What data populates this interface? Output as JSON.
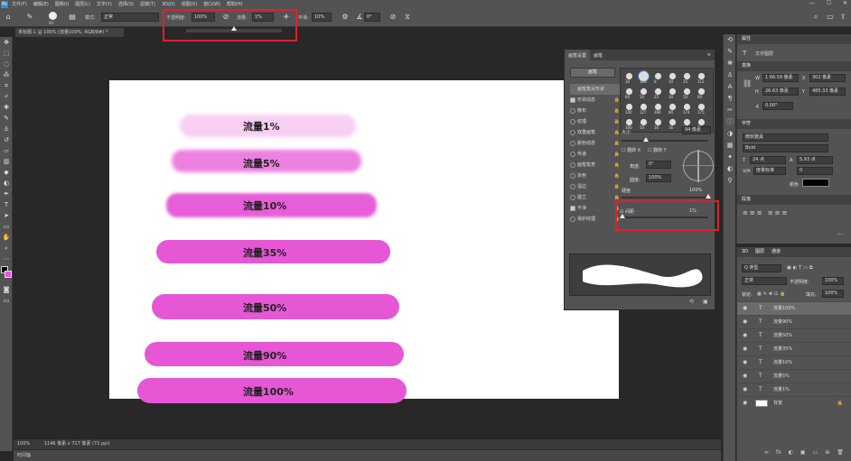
{
  "menu": [
    "文件(F)",
    "编辑(E)",
    "图像(I)",
    "图层(L)",
    "文字(Y)",
    "选择(S)",
    "滤镜(T)",
    "3D(D)",
    "视图(V)",
    "窗口(W)",
    "帮助(H)"
  ],
  "logo": "Ps",
  "window_controls": [
    "—",
    "☐",
    "✕"
  ],
  "options": {
    "size": "94",
    "mode_label": "模式:",
    "mode_value": "正常",
    "opacity_label": "不透明度:",
    "opacity_value": "100%",
    "flow_label": "流量:",
    "flow_value": "1%",
    "smooth_label": "平滑:",
    "smooth_value": "10%",
    "angle_value": "0°"
  },
  "flow_slider_fraction": 0.5,
  "doc_tab": "未标题-1 @ 100% (流量100%, RGB/8#) *",
  "canvas_strokes": [
    {
      "label": "流量1%"
    },
    {
      "label": "流量5%"
    },
    {
      "label": "流量10%"
    },
    {
      "label": "流量35%"
    },
    {
      "label": "流量50%"
    },
    {
      "label": "流量90%"
    },
    {
      "label": "流量100%"
    }
  ],
  "status": {
    "zoom": "100%",
    "doc_info": "1146 像素 x 717 像素 (72 ppi)"
  },
  "timeline_label": "时间轴",
  "brush_panel": {
    "tabs": [
      "画笔设置",
      "画笔"
    ],
    "preset_button": "画笔",
    "options": [
      {
        "label": "画笔笔尖形状",
        "checked": false,
        "highlight": true
      },
      {
        "label": "形状动态",
        "checked": true
      },
      {
        "label": "散布",
        "checked": false
      },
      {
        "label": "纹理",
        "checked": false
      },
      {
        "label": "双重画笔",
        "checked": false
      },
      {
        "label": "颜色动态",
        "checked": false
      },
      {
        "label": "传递",
        "checked": false
      },
      {
        "label": "画笔笔势",
        "checked": false
      },
      {
        "label": "杂色",
        "checked": false
      },
      {
        "label": "湿边",
        "checked": false
      },
      {
        "label": "建立",
        "checked": false
      },
      {
        "label": "平滑",
        "checked": true
      },
      {
        "label": "保护纹理",
        "checked": false
      }
    ],
    "tip_sizes": [
      "30",
      "123",
      "8",
      "10",
      "25",
      "112",
      "60",
      "50",
      "25",
      "30",
      "50",
      "60",
      "100",
      "127",
      "284",
      "80",
      "174",
      "175",
      "306",
      "50",
      "16",
      "36",
      "14",
      "24"
    ],
    "size_label": "大小",
    "size_value": "94 像素",
    "flip_x": "翻转 X",
    "flip_y": "翻转 Y",
    "angle_label": "角度:",
    "angle_value": "0°",
    "roundness_label": "圆度:",
    "roundness_value": "100%",
    "hardness_label": "硬度",
    "hardness_value": "100%",
    "spacing_label": "间距",
    "spacing_value": "1%",
    "spacing_fraction": 0.01
  },
  "right_panel": {
    "props_tab": "属性",
    "props_subtitle": "文字图层",
    "transform_label": "变换",
    "w_value": "1 66.59 像素",
    "h_value": "26.63 像素",
    "x_value": "302 像素",
    "y_value": "485.33 像素",
    "angle_value": "0.00°",
    "char_label": "字符",
    "font": "微软雅黑",
    "style": "Bold",
    "font_size": "24 点",
    "leading": "5.93 点",
    "va_label": "V/A",
    "tracking": "0",
    "kerning": "度量标准",
    "color_label": "颜色",
    "para_label": "段落"
  },
  "layers_panel": {
    "tabs": [
      "3D",
      "图层",
      "通道"
    ],
    "kind": "Q 类型",
    "blend": "正常",
    "opacity_label": "不透明度:",
    "opacity_value": "100%",
    "lock_label": "锁定:",
    "fill_label": "填充:",
    "fill_value": "100%",
    "layers": [
      {
        "name": "流量100%",
        "type": "text",
        "selected": true
      },
      {
        "name": "流量90%",
        "type": "text"
      },
      {
        "name": "流量50%",
        "type": "text"
      },
      {
        "name": "流量35%",
        "type": "text"
      },
      {
        "name": "流量10%",
        "type": "text"
      },
      {
        "name": "流量5%",
        "type": "text"
      },
      {
        "name": "流量1%",
        "type": "text"
      },
      {
        "name": "背景",
        "type": "image"
      }
    ],
    "footer_icons": [
      "∞",
      "fx",
      "◐",
      "▣",
      "▭",
      "⊕",
      "🗑"
    ]
  },
  "colors": {
    "accent_red": "#e0202c",
    "stroke_pink": "#e657d6",
    "fg_color": "#000000",
    "bg_color": "#e657d6"
  }
}
